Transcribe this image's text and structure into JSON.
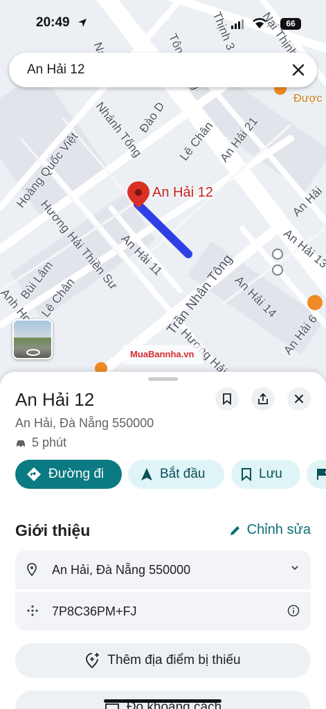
{
  "status_bar": {
    "time": "20:49",
    "battery": "66"
  },
  "search": {
    "query": "An Hải 12"
  },
  "map": {
    "pin_label": "An Hải 12",
    "watermark": "MuaBannha.vn",
    "street_labels": [
      "Tôn Quang",
      "Nại",
      "Thịnh 3",
      "Nại Thịnh 1",
      "Nhánh Tống",
      "Đào D",
      "Lê Chân",
      "An Hải 21",
      "Hoàng Quốc Việt",
      "Hương Hải Thiền Sư",
      "An Hải 11",
      "An Hải 13",
      "An Hải 14",
      "Trần Nhân Tông",
      "Bùi Lâm",
      "Lê Chân",
      "Anh Hợi",
      "Hương Hải",
      "An Hải 6",
      "An Hải",
      "Được"
    ]
  },
  "place": {
    "title": "An Hải 12",
    "address": "An Hải, Đà Nẵng 550000",
    "eta": "5 phút"
  },
  "actions": {
    "directions": "Đường đi",
    "start": "Bắt đầu",
    "save": "Lưu"
  },
  "about": {
    "heading": "Giới thiệu",
    "edit": "Chỉnh sửa",
    "address_row": "An Hải, Đà Nẵng 550000",
    "plus_code": "7P8C36PM+FJ"
  },
  "buttons": {
    "add_missing": "Thêm địa điểm bị thiếu",
    "measure": "Đo khoảng cách"
  },
  "colors": {
    "accent": "#0b7a82",
    "route": "#2f3fe6",
    "pin": "#d93025"
  }
}
